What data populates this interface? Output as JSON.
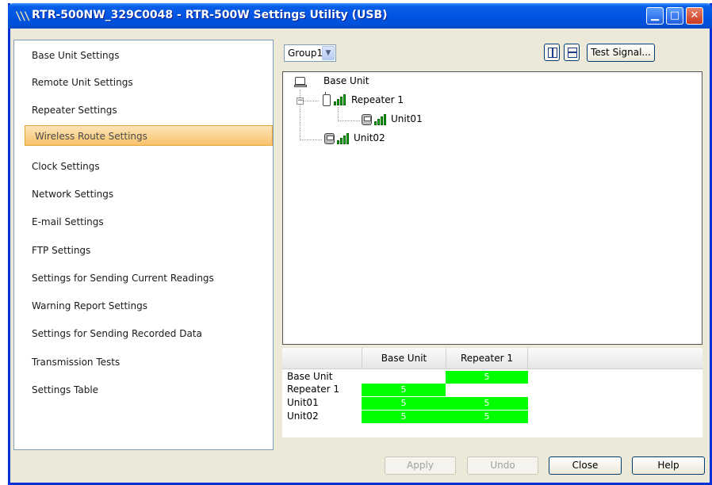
{
  "window": {
    "title": "RTR-500NW_329C0048 - RTR-500W Settings Utility (USB)",
    "icon": "app-logo-icon",
    "controls": [
      "minimize-icon",
      "maximize-icon",
      "close-icon"
    ]
  },
  "sidebar": {
    "items": [
      {
        "label": "Base Unit Settings"
      },
      {
        "label": "Remote Unit Settings"
      },
      {
        "label": "Repeater Settings"
      },
      {
        "label": "Wireless Route Settings",
        "selected": true
      },
      {
        "label": "Clock Settings"
      },
      {
        "label": "Network Settings"
      },
      {
        "label": "E-mail Settings"
      },
      {
        "label": "FTP Settings"
      },
      {
        "label": "Settings for Sending Current Readings"
      },
      {
        "label": "Warning Report Settings"
      },
      {
        "label": "Settings for Sending Recorded Data"
      },
      {
        "label": "Transmission Tests"
      },
      {
        "label": "Settings Table"
      }
    ]
  },
  "toolbar": {
    "group_value": "Group1",
    "test_signal_label": "Test Signal..."
  },
  "tree": {
    "root": "Base Unit",
    "repeater": "Repeater 1",
    "unit_under_repeater": "Unit01",
    "unit_direct": "Unit02"
  },
  "grid": {
    "columns": [
      "Base Unit",
      "Repeater 1"
    ],
    "rows": [
      {
        "label": "Base Unit",
        "cells": [
          "",
          "5"
        ]
      },
      {
        "label": "Repeater 1",
        "cells": [
          "5",
          ""
        ]
      },
      {
        "label": "Unit01",
        "cells": [
          "5",
          "5"
        ]
      },
      {
        "label": "Unit02",
        "cells": [
          "5",
          "5"
        ]
      }
    ],
    "highlight_color": "#00ff00"
  },
  "footer": {
    "apply_label": "Apply",
    "undo_label": "Undo",
    "close_label": "Close",
    "help_label": "Help"
  }
}
